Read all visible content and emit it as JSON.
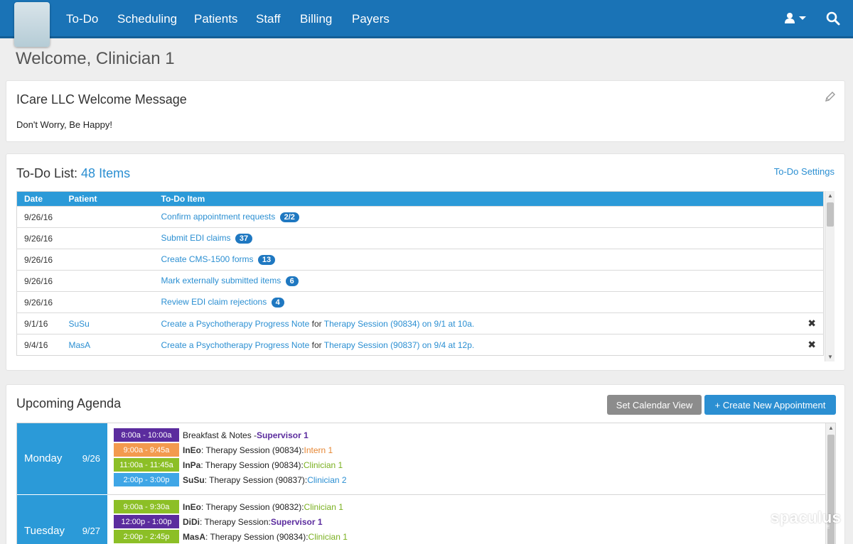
{
  "nav": {
    "items": [
      "To-Do",
      "Scheduling",
      "Patients",
      "Staff",
      "Billing",
      "Payers"
    ],
    "user_icon": "user-icon",
    "search_icon": "search-icon"
  },
  "page": {
    "title": "Welcome, Clinician 1"
  },
  "welcome": {
    "title": "ICare LLC Welcome Message",
    "body": "Don't Worry, Be Happy!",
    "edit_icon": "pencil-icon"
  },
  "todo": {
    "title": "To-Do List:",
    "count_label": "48 Items",
    "settings_label": "To-Do Settings",
    "columns": [
      "Date",
      "Patient",
      "To-Do Item"
    ],
    "rows": [
      {
        "date": "9/26/16",
        "patient": "",
        "item": "Confirm appointment requests",
        "badge": "2/2"
      },
      {
        "date": "9/26/16",
        "patient": "",
        "item": "Submit EDI claims",
        "badge": "37"
      },
      {
        "date": "9/26/16",
        "patient": "",
        "item": "Create CMS-1500 forms",
        "badge": "13"
      },
      {
        "date": "9/26/16",
        "patient": "",
        "item": "Mark externally submitted items",
        "badge": "6"
      },
      {
        "date": "9/26/16",
        "patient": "",
        "item": "Review EDI claim rejections",
        "badge": "4"
      },
      {
        "date": "9/1/16",
        "patient": "SuSu",
        "item": "Create a Psychotherapy Progress Note",
        "connector": "for",
        "detail": "Therapy Session (90834) on 9/1 at 10a.",
        "closable": true
      },
      {
        "date": "9/4/16",
        "patient": "MasA",
        "item": "Create a Psychotherapy Progress Note",
        "connector": "for",
        "detail": "Therapy Session (90837) on 9/4 at 12p.",
        "closable": true
      }
    ]
  },
  "agenda": {
    "title": "Upcoming Agenda",
    "set_calendar_label": "Set Calendar View",
    "create_label": "+ Create New Appointment",
    "days": [
      {
        "name": "Monday",
        "date": "9/26",
        "appointments": [
          {
            "time": "8:00a - 10:00a",
            "color": "#5b2c9e",
            "who": "Breakfast & Notes - ",
            "what": "",
            "staff": "Supervisor 1",
            "staff_color": "#5b2c9e"
          },
          {
            "time": "9:00a - 9:45a",
            "color": "#f39a4e",
            "who": "InEo",
            "what": ": Therapy Session (90834): ",
            "staff": "Intern 1",
            "staff_color": "#e68632"
          },
          {
            "time": "11:00a - 11:45a",
            "color": "#8cbf26",
            "who": "InPa",
            "what": ": Therapy Session (90834): ",
            "staff": "Clinician 1",
            "staff_color": "#7ab020"
          },
          {
            "time": "2:00p - 3:00p",
            "color": "#3fa6e6",
            "who": "SuSu",
            "what": ": Therapy Session (90837): ",
            "staff": "Clinician 2",
            "staff_color": "#2b8fd2"
          }
        ]
      },
      {
        "name": "Tuesday",
        "date": "9/27",
        "appointments": [
          {
            "time": "9:00a - 9:30a",
            "color": "#8cbf26",
            "who": "InEo",
            "what": ": Therapy Session (90832): ",
            "staff": "Clinician 1",
            "staff_color": "#7ab020"
          },
          {
            "time": "12:00p - 1:00p",
            "color": "#5b2c9e",
            "who": "DiDi",
            "what": ": Therapy Session: ",
            "staff": "Supervisor 1",
            "staff_color": "#5b2c9e"
          },
          {
            "time": "2:00p - 2:45p",
            "color": "#8cbf26",
            "who": "MasA",
            "what": ": Therapy Session (90834): ",
            "staff": "Clinician 1",
            "staff_color": "#7ab020"
          }
        ]
      }
    ]
  },
  "watermark": {
    "brand": "spaculus",
    "sub": "SOFTWARE"
  }
}
